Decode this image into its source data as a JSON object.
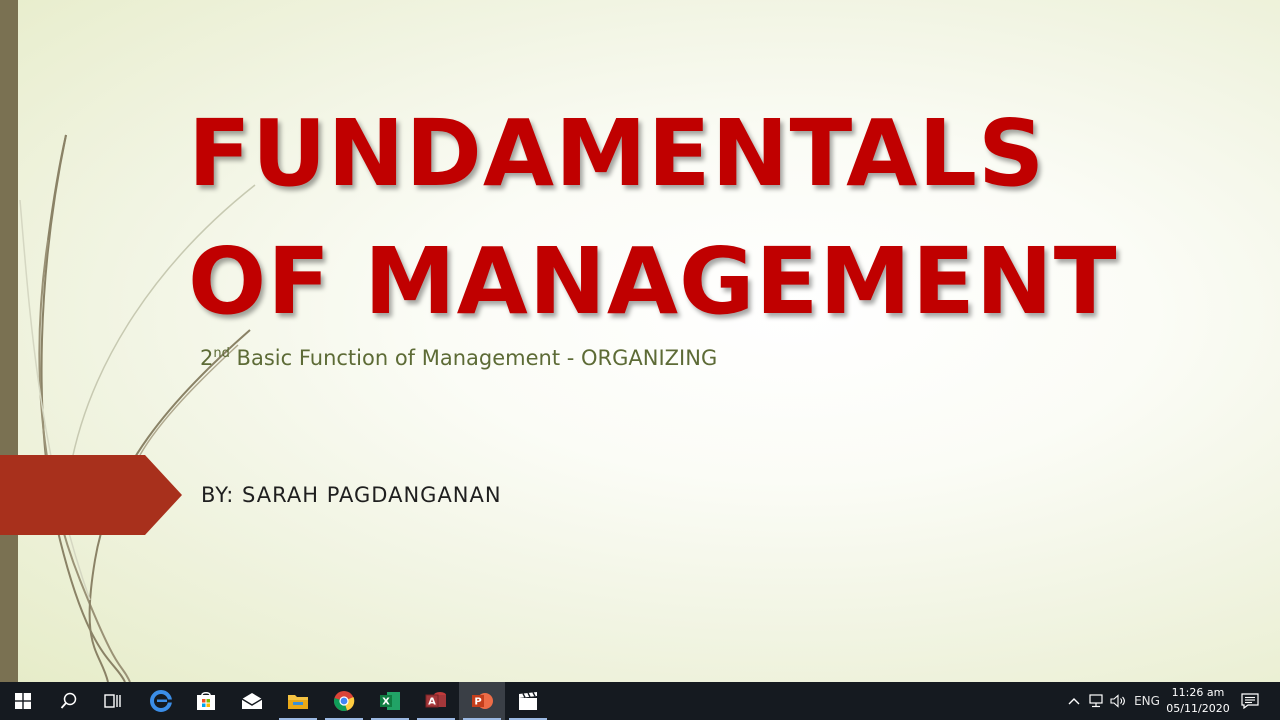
{
  "slide": {
    "title_line1": "FUNDAMENTALS",
    "title_line2": "OF MANAGEMENT",
    "subtitle_prefix": "2",
    "subtitle_superscript": "nd",
    "subtitle_text": " Basic Function of Management - ORGANIZING",
    "author": "BY: SARAH PAGDANGANAN",
    "colors": {
      "title": "#c00000",
      "subtitle": "#5d6b36",
      "accent_arrow": "#a8301c",
      "left_bar": "#7a7152"
    }
  },
  "taskbar": {
    "icons": [
      {
        "name": "windows-start-icon"
      },
      {
        "name": "search-icon"
      },
      {
        "name": "task-view-icon"
      },
      {
        "name": "edge-icon"
      },
      {
        "name": "store-icon"
      },
      {
        "name": "mail-icon"
      },
      {
        "name": "file-explorer-icon"
      },
      {
        "name": "chrome-icon"
      },
      {
        "name": "excel-icon"
      },
      {
        "name": "access-icon"
      },
      {
        "name": "powerpoint-icon"
      },
      {
        "name": "video-editor-icon"
      }
    ],
    "tray": {
      "language": "ENG",
      "time": "11:26 am",
      "date": "05/11/2020"
    }
  }
}
